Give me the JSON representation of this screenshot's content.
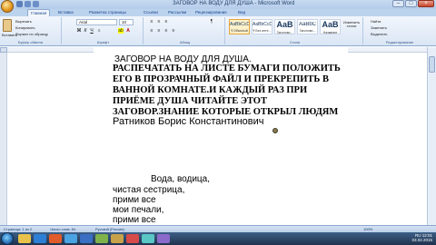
{
  "window": {
    "title": "ЗАГОВОР НА ВОДУ ДЛЯ ДУША - Microsoft Word"
  },
  "tabs": [
    "Главная",
    "Вставка",
    "Разметка страницы",
    "Ссылки",
    "Рассылки",
    "Рецензирование",
    "Вид"
  ],
  "ribbon": {
    "clipboard": {
      "paste_label": "Вставить",
      "cut_label": "Вырезать",
      "copy_label": "Копировать",
      "format_label": "Формат по образцу",
      "group_label": "Буфер обмена"
    },
    "font": {
      "name": "Arial",
      "size": "10",
      "group_label": "Шрифт"
    },
    "paragraph": {
      "group_label": "Абзац"
    },
    "styles": {
      "items": [
        {
          "sample": "AaBbCcDc",
          "name": "¶ Обычный"
        },
        {
          "sample": "AaBbCcDc",
          "name": "¶ Без инте..."
        },
        {
          "sample": "AaB",
          "name": "Заголово..."
        },
        {
          "sample": "AaBbC",
          "name": "Заголово..."
        },
        {
          "sample": "AaB",
          "name": "Название"
        }
      ],
      "group_label": "Стили",
      "change_label": "Изменить стили"
    },
    "editing": {
      "find_label": "Найти",
      "replace_label": "Заменить",
      "select_label": "Выделить",
      "group_label": "Редактирование"
    }
  },
  "document": {
    "lines": [
      "ЗАГОВОР НА ВОДУ ДЛЯ ДУША.",
      "РАСПЕЧАТАТЬ НА ЛИСТЕ БУМАГИ ПОЛОЖИТЬ",
      "ЕГО В ПРОЗРАЧНЫЙ ФАЙЛ И ПРЕКРЕПИТЬ В",
      "ВАННОЙ КОМНАТЕ.И КАЖДЫЙ РАЗ ПРИ",
      "ПРИЁМЕ ДУША ЧИТАЙТЕ ЭТОТ",
      "ЗАГОВОР.ЗНАНИЕ КОТОРЫЕ ОТКРЫЛ ЛЮДЯМ",
      "Ратников  Борис  Константинович",
      "Вода, водица,",
      "чистая сестрица,",
      "прими все",
      "мои печали,",
      "прими все"
    ]
  },
  "status": {
    "page": "Страница: 1 из 2",
    "words": "Число слов: 84",
    "lang": "Русский (Россия)",
    "zoom": "100%"
  },
  "taskbar": {
    "lang": "RU",
    "time": "12:01",
    "date": "03.02.2015"
  }
}
